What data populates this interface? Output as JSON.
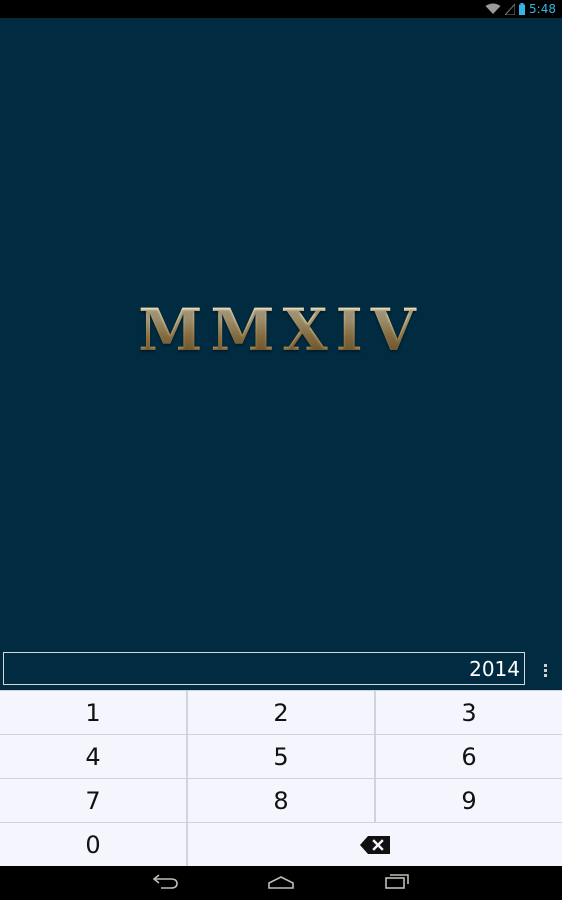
{
  "status_bar": {
    "time": "5:48",
    "icons": [
      "wifi-icon",
      "signal-icon",
      "battery-icon"
    ]
  },
  "display": {
    "roman_numeral": "MMXIV"
  },
  "input": {
    "value": "2014"
  },
  "keypad": {
    "keys": [
      "1",
      "2",
      "3",
      "4",
      "5",
      "6",
      "7",
      "8",
      "9",
      "0"
    ],
    "backspace_icon": "backspace-icon"
  },
  "nav_bar": {
    "icons": [
      "back-icon",
      "home-icon",
      "recent-apps-icon"
    ]
  },
  "colors": {
    "background": "#012b40",
    "status_accent": "#33b5e5",
    "keypad_key": "#f4f5fd",
    "numeral_gold": "#c8a262"
  }
}
